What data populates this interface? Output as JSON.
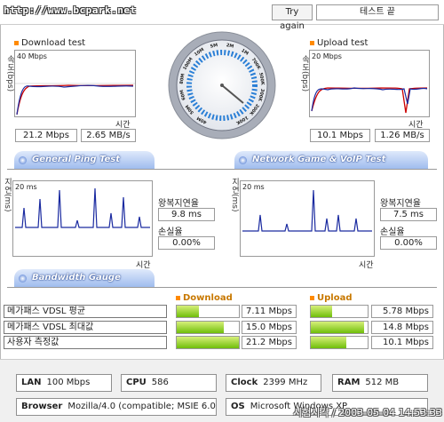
{
  "header": {
    "url": "http://www.bcpark.net",
    "try_again": "Try again",
    "status": "테스트 끝"
  },
  "download": {
    "title": "Download test",
    "ylabel": "속도(bps)",
    "scale": "40 Mbps",
    "xlabel": "시간",
    "speed": "21.2 Mbps",
    "bytes": "2.65 MB/s"
  },
  "upload": {
    "title": "Upload test",
    "ylabel": "속도(bps)",
    "scale": "20 Mbps",
    "xlabel": "시간",
    "speed": "10.1 Mbps",
    "bytes": "1.26 MB/s"
  },
  "gauge": {
    "ticks": [
      "40M",
      "50M",
      "60M",
      "80M",
      "100M",
      "10M",
      "5M",
      "2M",
      "1M",
      "700K",
      "500K",
      "300K",
      "200K",
      "100K"
    ],
    "needle_value_mbps": 21.2
  },
  "ping": {
    "tab": "General Ping Test",
    "ylabel": "지연(ms)",
    "scale": "20 ms",
    "xlabel": "시간",
    "rtt_label": "왕복지연율",
    "rtt": "9.8 ms",
    "loss_label": "손실율",
    "loss": "0.00%"
  },
  "voip": {
    "tab": "Network Game & VoIP Test",
    "ylabel": "지연(ms)",
    "scale": "20 ms",
    "xlabel": "시간",
    "rtt_label": "왕복지연율",
    "rtt": "7.5 ms",
    "loss_label": "손실율",
    "loss": "0.00%"
  },
  "bandwidth": {
    "tab": "Bandwidth Gauge",
    "download_header": "Download",
    "upload_header": "Upload",
    "rows": [
      {
        "label": "메가패스 VDSL 평균",
        "down": "7.11 Mbps",
        "down_frac": 0.36,
        "up": "5.78 Mbps",
        "up_frac": 0.37
      },
      {
        "label": "메가패스 VDSL 최대값",
        "down": "15.0 Mbps",
        "down_frac": 0.76,
        "up": "14.8 Mbps",
        "up_frac": 0.94
      },
      {
        "label": "사용자 측정값",
        "down": "21.2 Mbps",
        "down_frac": 1.0,
        "up": "10.1 Mbps",
        "up_frac": 0.62
      }
    ]
  },
  "system": {
    "lan_label": "LAN",
    "lan": "100 Mbps",
    "cpu_label": "CPU",
    "cpu": "586",
    "clock_label": "Clock",
    "clock": "2399 MHz",
    "ram_label": "RAM",
    "ram": "512 MB",
    "browser_label": "Browser",
    "browser": "Mozilla/4.0 (compatible; MSIE 6.0",
    "os_label": "OS",
    "os": "Microsoft Windows XP"
  },
  "footer": {
    "timestamp": "시험시각 / 2003-05-04 14:53:33"
  }
}
